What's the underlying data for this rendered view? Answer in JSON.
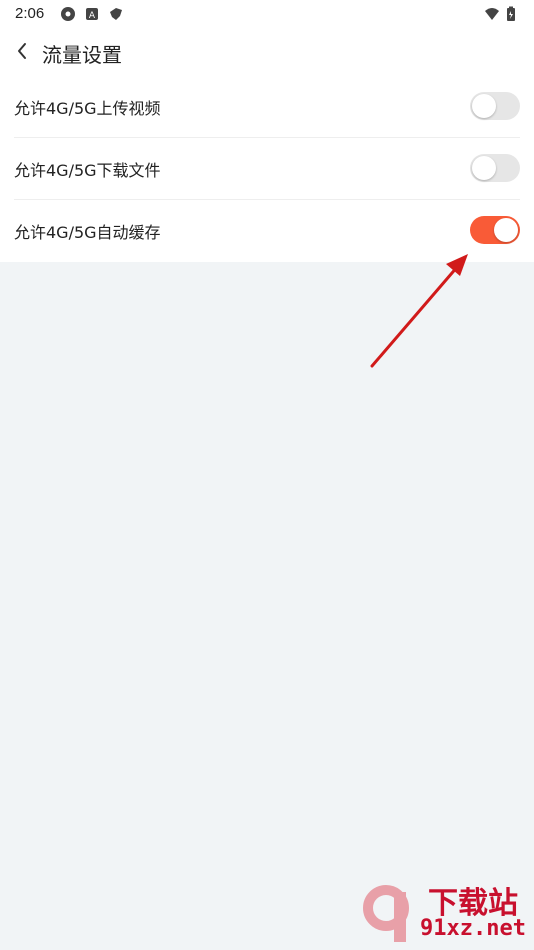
{
  "status_bar": {
    "time": "2:06"
  },
  "header": {
    "title": "流量设置"
  },
  "settings": [
    {
      "label": "允许4G/5G上传视频",
      "enabled": false
    },
    {
      "label": "允许4G/5G下载文件",
      "enabled": false
    },
    {
      "label": "允许4G/5G自动缓存",
      "enabled": true
    }
  ],
  "watermark": {
    "title": "下载站",
    "domain": "91xz.net"
  },
  "colors": {
    "accent": "#f95b37",
    "toggle_off": "#e6e6e6",
    "background": "#f1f4f6",
    "annotation_arrow": "#d11a1a"
  }
}
